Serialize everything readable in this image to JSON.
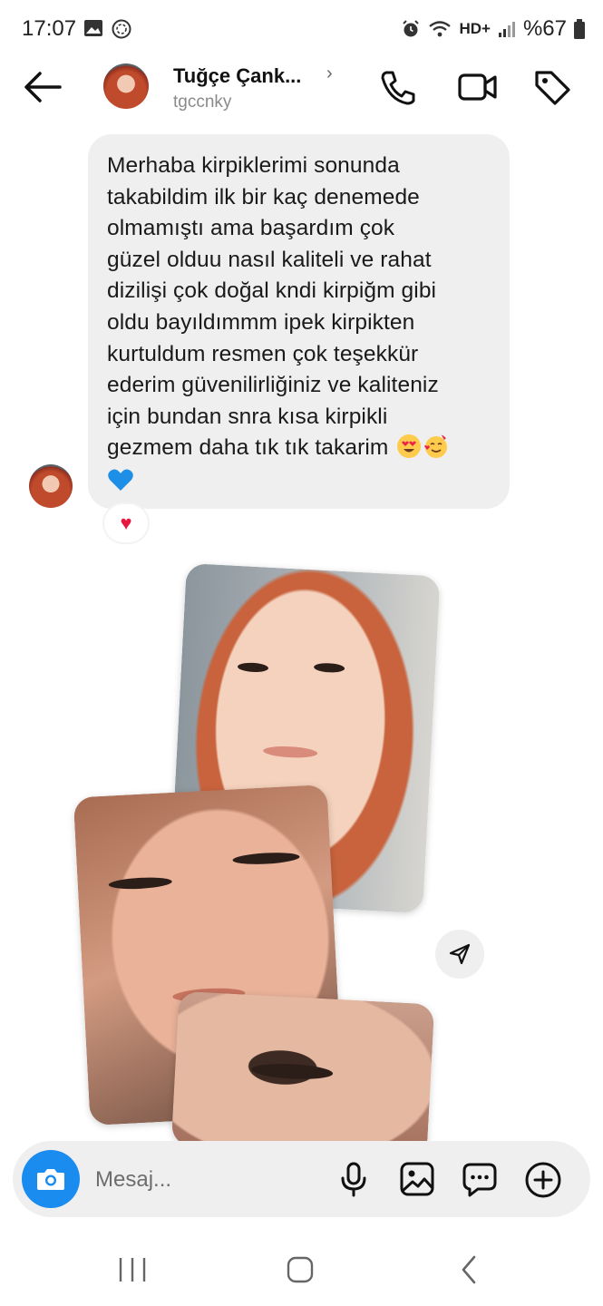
{
  "status_bar": {
    "time": "17:07",
    "network": "HD+",
    "battery": "%67"
  },
  "header": {
    "name": "Tuğçe Çank...",
    "chevron": "›",
    "username": "tgccnky"
  },
  "message": {
    "lines": [
      "Merhaba kirpiklerimi sonunda",
      "takabildim ilk bir kaç denemede",
      "olmamıştı ama başardım çok",
      "güzel olduu nasıl kaliteli ve rahat",
      "dizilişi çok doğal kndi kirpiğm gibi",
      "oldu bayıldımmm ipek kirpikten",
      "kurtuldum resmen çok teşekkür",
      "ederim güvenilirliğiniz ve kaliteniz",
      "için bundan snra kısa kirpikli",
      "gezmem daha tık tık takarim"
    ],
    "emojis": [
      "heart-eyes-emoji",
      "smiling-face-with-hearts-emoji",
      "blue-heart-emoji"
    ],
    "reaction": "♥"
  },
  "composer": {
    "placeholder": "Mesaj..."
  },
  "colors": {
    "accent": "#1a8cf0",
    "bubble": "#efefef",
    "reaction": "#e6173f"
  },
  "icons": {
    "header": [
      "back-arrow-icon",
      "phone-icon",
      "video-camera-icon",
      "tag-icon"
    ],
    "composer": [
      "camera-icon",
      "microphone-icon",
      "gallery-icon",
      "sticker-chat-icon",
      "plus-circle-icon"
    ],
    "nav": [
      "recent-apps-icon",
      "home-icon",
      "back-icon"
    ]
  }
}
